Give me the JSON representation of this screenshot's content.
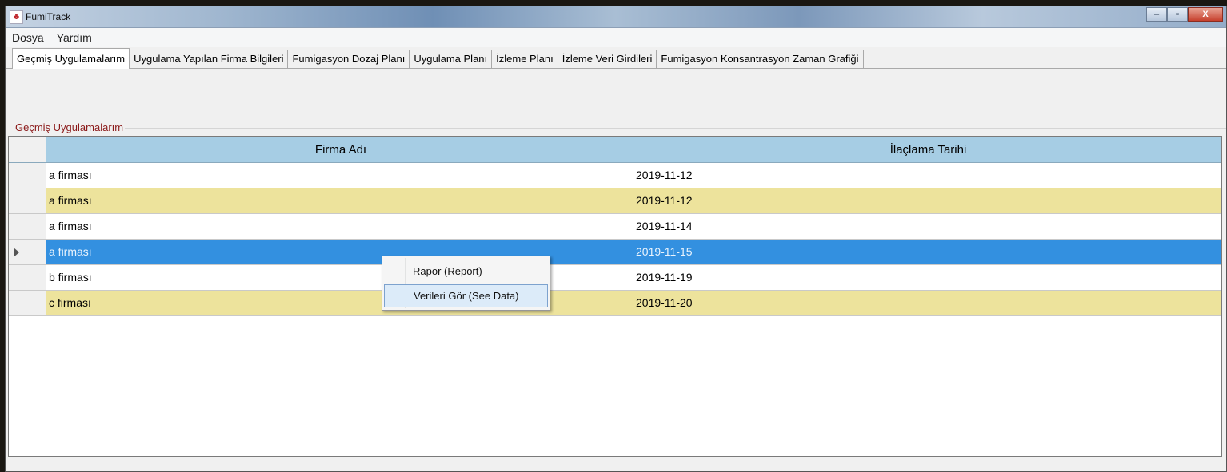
{
  "window": {
    "title": "FumiTrack",
    "icon": "app-logo-icon",
    "controls": {
      "minimize": "–",
      "maximize": "▫",
      "close": "X"
    }
  },
  "menu": {
    "items": [
      "Dosya",
      "Yardım"
    ]
  },
  "tabs": [
    {
      "label": "Geçmiş Uygulamalarım",
      "active": true
    },
    {
      "label": "Uygulama Yapılan Firma Bilgileri"
    },
    {
      "label": "Fumigasyon Dozaj Planı"
    },
    {
      "label": "Uygulama Planı"
    },
    {
      "label": "İzleme Planı"
    },
    {
      "label": "İzleme Veri Girdileri"
    },
    {
      "label": "Fumigasyon Konsantrasyon Zaman Grafiği"
    }
  ],
  "group": {
    "title": "Geçmiş Uygulamalarım"
  },
  "grid": {
    "columns": [
      "Firma Adı",
      "İlaçlama Tarihi"
    ],
    "rows": [
      {
        "firma": "a firması",
        "tarih": "2019-11-12"
      },
      {
        "firma": "a firması",
        "tarih": "2019-11-12"
      },
      {
        "firma": "a firması",
        "tarih": "2019-11-14"
      },
      {
        "firma": "a firması",
        "tarih": "2019-11-15"
      },
      {
        "firma": "b firması",
        "tarih": "2019-11-19"
      },
      {
        "firma": "c firması",
        "tarih": "2019-11-20"
      }
    ],
    "alt_row_color": "#ede39c",
    "selected_row_color": "#3390e0",
    "header_color": "#a6cde4"
  },
  "context_menu": {
    "items": [
      "Rapor (Report)",
      "Verileri Gör (See Data)"
    ]
  }
}
